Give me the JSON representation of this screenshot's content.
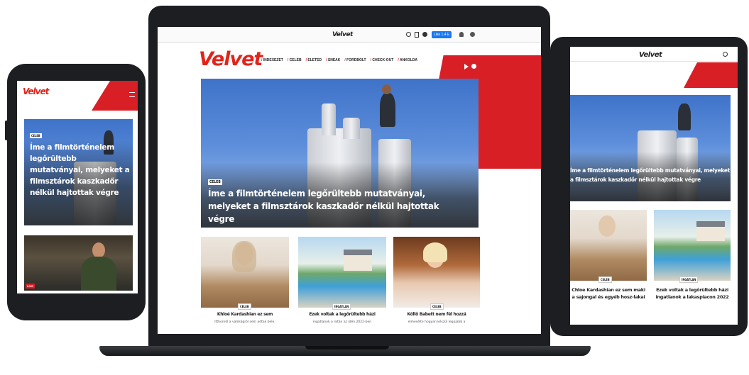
{
  "brand": {
    "logo_text": "Velvet",
    "accent_color": "#d91f26",
    "logo_color": "#e2231a"
  },
  "laptop": {
    "top_logo": "Velvet",
    "follow_button": "Like 1,4 E",
    "nav": [
      "INDEXEZET",
      "CELEB",
      "ELETED",
      "SNEAK",
      "FORDBOLT",
      "CHECK-OUT",
      "ANKOLDA"
    ],
    "hero": {
      "tag": "CELEB",
      "headline": "Íme a filmtörténelem legőrültebb mutatványai, melyeket a filmsztárok kaszkadőr nélkül hajtottak végre"
    },
    "cards": [
      {
        "tag": "CELEB",
        "title": "Khloé Kardashian ez sem",
        "sub": "Itthonról a valóságról sem adtak bele."
      },
      {
        "tag": "INGATLAN",
        "title": "Ezek voltak a legőrültebb házi",
        "sub": "ingatlanok a listán az idén 2022-ben"
      },
      {
        "tag": "CELEB",
        "title": "Köllő Babett nem fél hozzá",
        "sub": "elmesélte hogyan készül legújabb a"
      }
    ]
  },
  "phone": {
    "logo": "Velvet",
    "hero": {
      "tag": "CELEB",
      "headline": "Íme a filmtörténelem legőrültebb mutatványai, melyeket a filmsztárok kaszkadőr nélkül hajtottak végre"
    },
    "second_tag": "LIVE"
  },
  "tablet": {
    "logo": "Velvet",
    "hero": {
      "headline": "Íme a filmtörténelem legőrültebb mutatványai, melyeket a filmsztárok kaszkadőr nélkül hajtottak végre"
    },
    "cards": [
      {
        "tag": "CELEB",
        "title": "Chloe Kardashian ez sem maki a sajongal és egyéb hosz-lakai"
      },
      {
        "tag": "INGATLAN",
        "title": "Ezek voltak a legőrültebb házi ingatlanok a lakaspiacon 2022"
      }
    ]
  },
  "icons": [
    "search-icon",
    "bookmark-icon",
    "menu-icon",
    "user-icon",
    "bell-icon",
    "play-icon",
    "hamburger-icon"
  ]
}
